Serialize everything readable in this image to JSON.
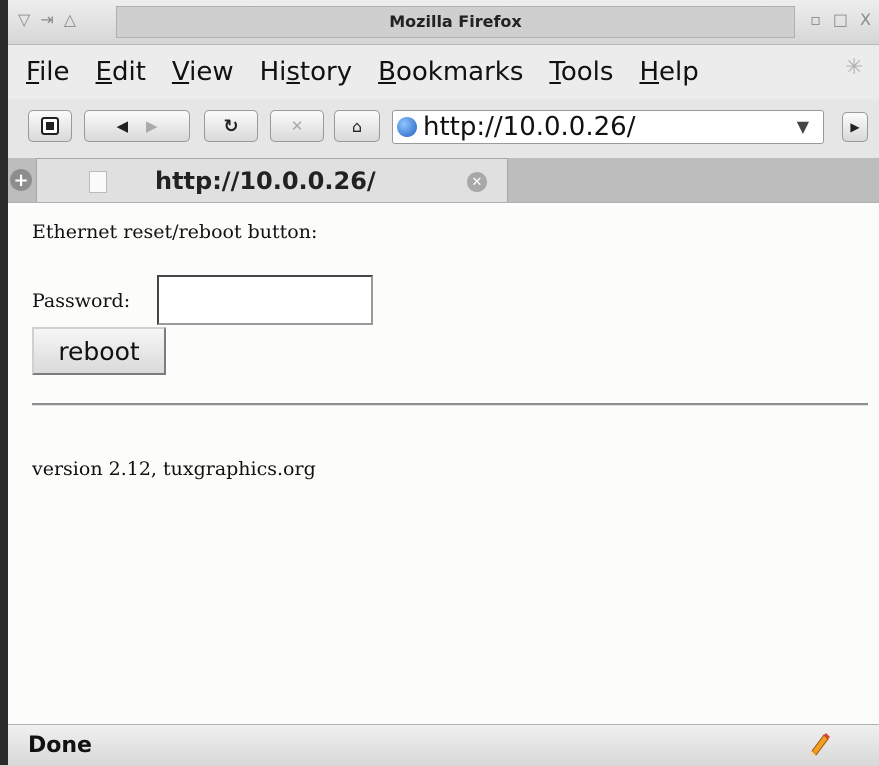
{
  "window": {
    "title": "Mozilla Firefox",
    "left_controls": [
      "▽",
      "⇥",
      "△"
    ],
    "right_controls": [
      "▫",
      "□",
      "X"
    ]
  },
  "menubar": {
    "items": [
      {
        "label": "File",
        "underline": "F"
      },
      {
        "label": "Edit",
        "underline": "E"
      },
      {
        "label": "View",
        "underline": "V"
      },
      {
        "label": "History",
        "underline": "s"
      },
      {
        "label": "Bookmarks",
        "underline": "B"
      },
      {
        "label": "Tools",
        "underline": "T"
      },
      {
        "label": "Help",
        "underline": "H"
      }
    ]
  },
  "navbar": {
    "url": "http://10.0.0.26/"
  },
  "tabs": [
    {
      "label": "http://10.0.0.26/"
    }
  ],
  "page": {
    "heading_text": "Ethernet reset/reboot button:",
    "password_label": "Password:",
    "password_value": "",
    "reboot_label": "reboot",
    "version_text": "version 2.12, tuxgraphics.org"
  },
  "status": {
    "text": "Done"
  }
}
